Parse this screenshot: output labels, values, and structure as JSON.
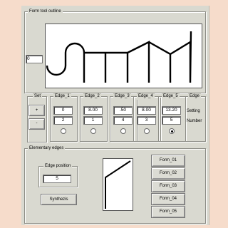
{
  "form_tool": {
    "title": "Form tool outline",
    "position_value": "0"
  },
  "set": {
    "title": "Set",
    "plus_label": "+",
    "minus_label": "-"
  },
  "edges": [
    {
      "label": "Edge_1",
      "value": "0",
      "number": "2",
      "selected": false
    },
    {
      "label": "Edge_2",
      "value": "8.00",
      "number": "1",
      "selected": false
    },
    {
      "label": "Edge_3",
      "value": ".50",
      "number": "4",
      "selected": false
    },
    {
      "label": "Edge_4",
      "value": "8.00",
      "number": "3",
      "selected": false
    },
    {
      "label": "Edge_5",
      "value": "13.20",
      "number": "5",
      "selected": true
    }
  ],
  "edge_legend": {
    "title": "Edge",
    "setting": "Setting",
    "number": "Number"
  },
  "elementary": {
    "title": "Elementary edges",
    "edge_position_label": "Edge position",
    "edge_position_value": "5",
    "synthesis_label": "Synthezis",
    "forms": [
      "Form_01",
      "Form_02",
      "Form_03",
      "Form_04",
      "Form_05"
    ]
  }
}
